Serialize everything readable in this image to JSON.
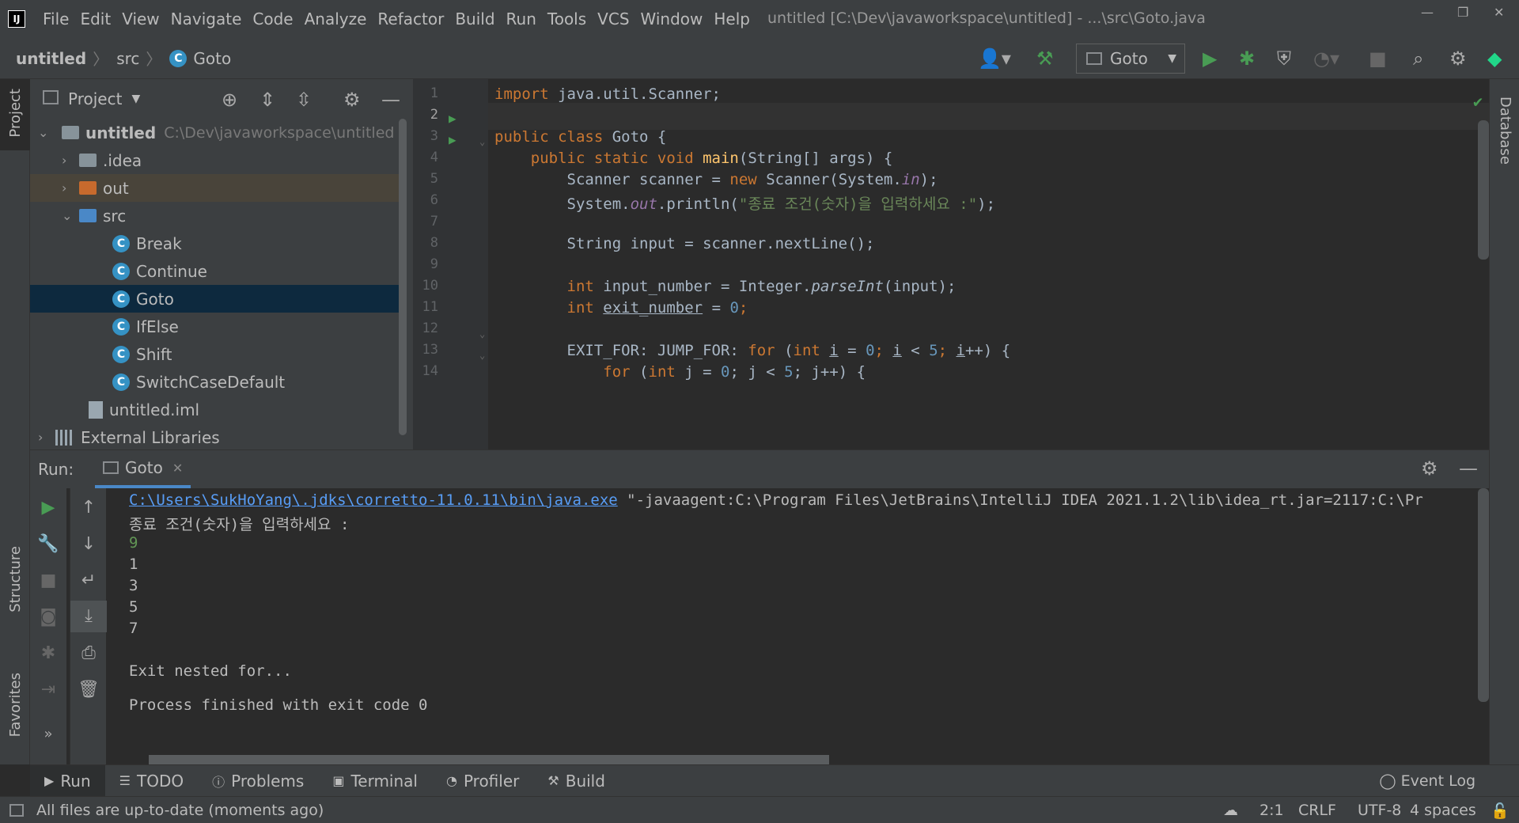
{
  "menu": [
    "File",
    "Edit",
    "View",
    "Navigate",
    "Code",
    "Analyze",
    "Refactor",
    "Build",
    "Run",
    "Tools",
    "VCS",
    "Window",
    "Help"
  ],
  "window_title": "untitled [C:\\Dev\\javaworkspace\\untitled] - ...\\src\\Goto.java",
  "breadcrumb": {
    "project": "untitled",
    "folder": "src",
    "file": "Goto"
  },
  "run_config": "Goto",
  "left_tabs": {
    "project": "Project",
    "structure": "Structure",
    "favorites": "Favorites"
  },
  "right_tabs": {
    "database": "Database"
  },
  "project_panel": {
    "title": "Project",
    "root": {
      "name": "untitled",
      "path": "C:\\Dev\\javaworkspace\\untitled"
    },
    "items": [
      ".idea",
      "out",
      "src",
      "Break",
      "Continue",
      "Goto",
      "IfElse",
      "Shift",
      "SwitchCaseDefault",
      "untitled.iml",
      "External Libraries"
    ]
  },
  "editor": {
    "line_numbers": [
      "1",
      "2",
      "3",
      "4",
      "5",
      "6",
      "7",
      "8",
      "9",
      "10",
      "11",
      "12",
      "13",
      "14"
    ],
    "lines": {
      "l1": "java.util.Scanner;",
      "l3_cls": "Goto {",
      "l4_sig": "(String[] args) {",
      "l5_a": "Scanner scanner = ",
      "l5_b": " Scanner(System.",
      "l5_c": ");",
      "l6_a": "System.",
      "l6_b": ".println(",
      "l6_str": "\"종료 조건(숫자)을 입력하세요 :\"",
      "l6_c": ");",
      "l8": "String input = scanner.nextLine();",
      "l10_a": " input_number = Integer.",
      "l10_fn": "parseInt",
      "l10_b": "(input);",
      "l11_var": "exit_number",
      "l11_b": " = ",
      "l11_num": "0",
      "l13_a": "EXIT_FOR: JUMP_FOR: ",
      "l13_b": " (",
      "l14_b": " (",
      "l14_c": " j = ",
      "l14_d": "; j < ",
      "l14_e": "; j++) {"
    }
  },
  "run_panel": {
    "label": "Run:",
    "tab": "Goto",
    "console": {
      "cmd_link": "C:\\Users\\SukHoYang\\.jdks\\corretto-11.0.11\\bin\\java.exe",
      "cmd_rest": " \"-javaagent:C:\\Program Files\\JetBrains\\IntelliJ IDEA 2021.1.2\\lib\\idea_rt.jar=2117:C:\\Pr",
      "prompt": "종료 조건(숫자)을 입력하세요 :",
      "input": "9",
      "outputs": [
        "1",
        "3",
        "5",
        "7"
      ],
      "exit_msg": "Exit nested for...",
      "finished": "Process finished with exit code 0"
    }
  },
  "tool_tabs": [
    "Run",
    "TODO",
    "Problems",
    "Terminal",
    "Profiler",
    "Build"
  ],
  "event_log": "Event Log",
  "status": {
    "message": "All files are up-to-date (moments ago)",
    "position": "2:1",
    "line_sep": "CRLF",
    "encoding": "UTF-8",
    "indent": "4 spaces"
  }
}
